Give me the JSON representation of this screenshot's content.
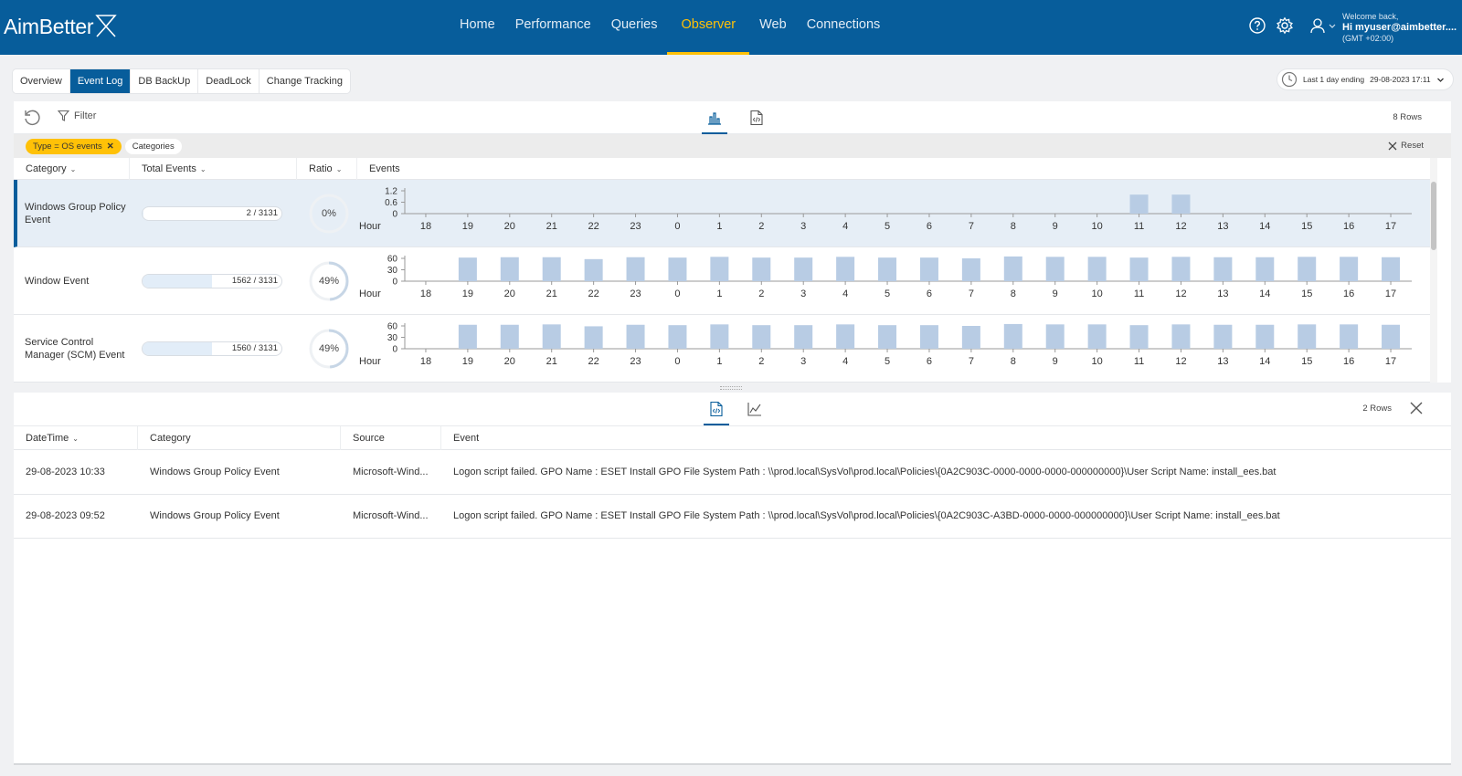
{
  "app": {
    "logo_text": "AimBetter"
  },
  "nav": {
    "items": [
      {
        "label": "Home",
        "active": false
      },
      {
        "label": "Performance",
        "active": false
      },
      {
        "label": "Queries",
        "active": false
      },
      {
        "label": "Observer",
        "active": true
      },
      {
        "label": "Web",
        "active": false
      },
      {
        "label": "Connections",
        "active": false
      }
    ]
  },
  "user": {
    "welcome": "Welcome back,",
    "name": "Hi myuser@aimbetter....",
    "timezone": "(GMT +02:00)"
  },
  "subtabs": [
    {
      "label": "Overview",
      "active": false
    },
    {
      "label": "Event Log",
      "active": true
    },
    {
      "label": "DB BackUp",
      "active": false
    },
    {
      "label": "DeadLock",
      "active": false
    },
    {
      "label": "Change Tracking",
      "active": false
    }
  ],
  "daterange": {
    "label": "Last 1 day ending",
    "value": "29-08-2023 17:11"
  },
  "top_panel": {
    "filter_label": "Filter",
    "row_count": "8 Rows",
    "chips": [
      {
        "label": "Type = OS events",
        "removable": true
      },
      {
        "label": "Categories",
        "removable": false
      }
    ],
    "reset_label": "Reset",
    "columns": [
      "Category",
      "Total Events",
      "Ratio",
      "Events"
    ],
    "hour_label": "Hour",
    "hours": [
      "18",
      "19",
      "20",
      "21",
      "22",
      "23",
      "0",
      "1",
      "2",
      "3",
      "4",
      "5",
      "6",
      "7",
      "8",
      "9",
      "10",
      "11",
      "12",
      "13",
      "14",
      "15",
      "16",
      "17"
    ],
    "rows": [
      {
        "category": "Windows Group Policy Event",
        "count": 2,
        "total": 3131,
        "total_text": "2 / 3131",
        "ratio": 0,
        "ratio_text": "0%",
        "y_ticks": [
          "1.2",
          "0.6",
          "0"
        ],
        "y_max": 1.2,
        "values": [
          0,
          0,
          0,
          0,
          0,
          0,
          0,
          0,
          0,
          0,
          0,
          0,
          0,
          0,
          0,
          0,
          0,
          1,
          1,
          0,
          0,
          0,
          0,
          0
        ],
        "selected": true
      },
      {
        "category": "Window Event",
        "count": 1562,
        "total": 3131,
        "total_text": "1562 / 3131",
        "ratio": 49,
        "ratio_text": "49%",
        "y_ticks": [
          "60",
          "30",
          "0"
        ],
        "y_max": 60,
        "values": [
          0,
          62,
          63,
          63,
          58,
          63,
          62,
          64,
          62,
          62,
          64,
          62,
          62,
          60,
          65,
          64,
          64,
          62,
          64,
          63,
          63,
          64,
          64,
          63
        ],
        "selected": false
      },
      {
        "category": "Service Control Manager (SCM) Event",
        "count": 1560,
        "total": 3131,
        "total_text": "1560 / 3131",
        "ratio": 49,
        "ratio_text": "49%",
        "y_ticks": [
          "60",
          "30",
          "0"
        ],
        "y_max": 60,
        "values": [
          0,
          63,
          63,
          64,
          59,
          63,
          62,
          64,
          62,
          62,
          64,
          62,
          62,
          60,
          65,
          64,
          64,
          62,
          64,
          63,
          63,
          64,
          64,
          63
        ],
        "selected": false
      }
    ]
  },
  "bottom_panel": {
    "row_count": "2 Rows",
    "columns": [
      "DateTime",
      "Category",
      "Source",
      "Event"
    ],
    "rows": [
      {
        "datetime": "29-08-2023 10:33",
        "category": "Windows Group Policy Event",
        "source": "Microsoft-Wind...",
        "event": "Logon script failed. GPO Name : ESET Install GPO File System Path : \\\\prod.local\\SysVol\\prod.local\\Policies\\{0A2C903C-0000-0000-0000-000000000}\\User Script Name: install_ees.bat"
      },
      {
        "datetime": "29-08-2023 09:52",
        "category": "Windows Group Policy Event",
        "source": "Microsoft-Wind...",
        "event": "Logon script failed. GPO Name : ESET Install GPO File System Path : \\\\prod.local\\SysVol\\prod.local\\Policies\\{0A2C903C-A3BD-0000-0000-000000000}\\User Script Name: install_ees.bat"
      }
    ]
  },
  "colors": {
    "brand": "#075d9b",
    "accent": "#ffc107",
    "bar": "#b8cce4"
  },
  "icons": {
    "help": "help-circle-icon",
    "settings": "gear-icon",
    "user": "user-icon",
    "refresh": "refresh-icon",
    "filter": "filter-icon",
    "chart": "bar-chart-icon",
    "code": "code-file-icon",
    "line_chart": "line-chart-icon",
    "close": "close-icon",
    "clock": "clock-icon"
  }
}
